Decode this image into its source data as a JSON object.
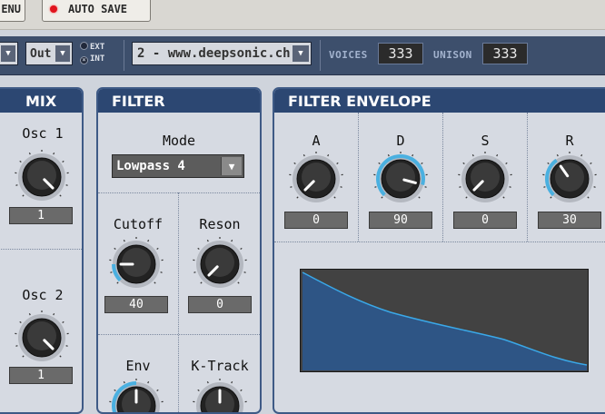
{
  "topbar": {
    "menu_label": "ENU",
    "autosave_label": "AUTO SAVE"
  },
  "toolbar": {
    "out_label": "Out",
    "ext_label": "EXT",
    "int_label": "INT",
    "preset_label": "2 - www.deepsonic.ch",
    "voices_label": "VOICES",
    "voices_value": "333",
    "unison_label": "UNISON",
    "unison_value": "333"
  },
  "mix": {
    "title": "MIX",
    "osc1": {
      "label": "Osc 1",
      "value": "1"
    },
    "osc2": {
      "label": "Osc 2",
      "value": "1"
    }
  },
  "filter": {
    "title": "FILTER",
    "mode_label": "Mode",
    "mode_value": "Lowpass 4",
    "cutoff": {
      "label": "Cutoff",
      "value": "40"
    },
    "reson": {
      "label": "Reson",
      "value": "0"
    },
    "env_label": "Env",
    "ktrack_label": "K-Track"
  },
  "envelope": {
    "title": "FILTER ENVELOPE",
    "a": {
      "label": "A",
      "value": "0"
    },
    "d": {
      "label": "D",
      "value": "90"
    },
    "s": {
      "label": "S",
      "value": "0"
    },
    "r": {
      "label": "R",
      "value": "30"
    }
  },
  "colors": {
    "panel_header": "#2c4772",
    "accent_ring": "#4ab0e0",
    "graph_fill": "#2e5585",
    "graph_line": "#3aa8e8",
    "led_red": "#e0141e"
  }
}
